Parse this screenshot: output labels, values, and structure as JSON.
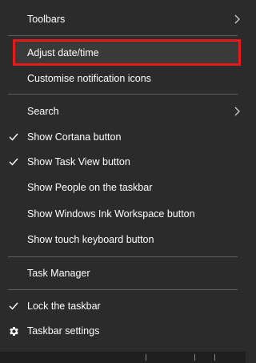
{
  "menu": {
    "toolbars": "Toolbars",
    "adjust_datetime": "Adjust date/time",
    "customise_notification_icons": "Customise notification icons",
    "search": "Search",
    "show_cortana": "Show Cortana button",
    "show_task_view": "Show Task View button",
    "show_people": "Show People on the taskbar",
    "show_ink_workspace": "Show Windows Ink Workspace button",
    "show_touch_keyboard": "Show touch keyboard button",
    "task_manager": "Task Manager",
    "lock_taskbar": "Lock the taskbar",
    "taskbar_settings": "Taskbar settings"
  },
  "checked": {
    "show_cortana": true,
    "show_task_view": true,
    "lock_taskbar": true
  },
  "colors": {
    "background": "#2b2b2b",
    "text": "#ffffff",
    "separator": "#5d5d5d",
    "highlight_border": "#e21b1b"
  },
  "icons": {
    "submenu": "chevron-right-icon",
    "check": "checkmark-icon",
    "settings": "gear-icon"
  }
}
